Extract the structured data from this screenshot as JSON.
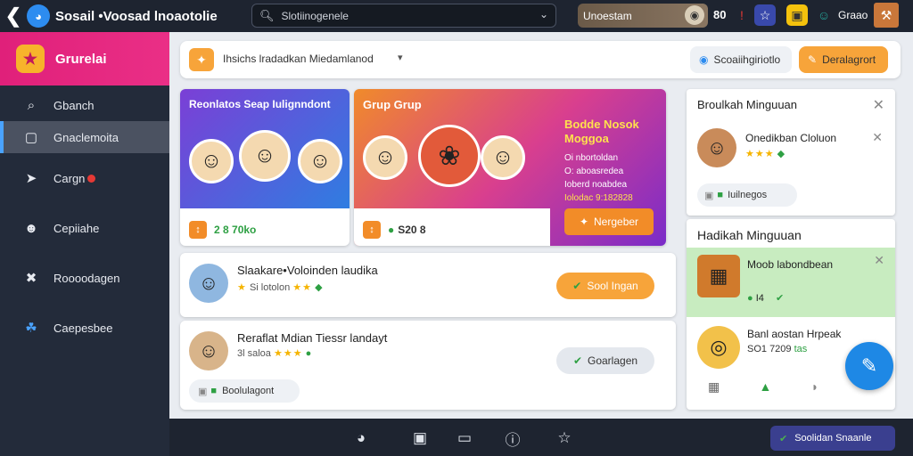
{
  "topbar": {
    "app_title": "Sosail •Voosad lnoaotolie",
    "search_text": "Slotiinogenele",
    "user_name": "Unoestam",
    "count": "80",
    "right_user": "Graao"
  },
  "sidebar": {
    "header": "Grurelai",
    "items": [
      {
        "label": "Gbanch",
        "icon": "search-icon"
      },
      {
        "label": "Gnaclemoita",
        "icon": "calendar-icon"
      },
      {
        "label": "Cargn",
        "icon": "rocket-icon"
      },
      {
        "label": "Cepiiahe",
        "icon": "profile-icon"
      },
      {
        "label": "Roooodagen",
        "icon": "tools-icon"
      },
      {
        "label": "Caepesbee",
        "icon": "creature-icon"
      }
    ]
  },
  "filterbar": {
    "text": "Ihsichs lradadkan Miedamlanod",
    "chip1": "Scoaiihgiriotlo",
    "chip2": "Deralagrort"
  },
  "cards": {
    "card1": {
      "title": "Reonlatos Seap Iulignndont",
      "stat": "2 8 70ko"
    },
    "card2": {
      "title": "Grup Grup",
      "stat": "S20 8",
      "promo_title": "Bodde Nosok Moggoa",
      "promo_lines": [
        "Oi nbortoldan",
        "O: aboasredea",
        "Ioberd noabdea",
        "Iolodac 9:182828"
      ],
      "promo_button": "Nergeber"
    }
  },
  "rows": [
    {
      "name": "Slaakare•Voloinden laudika",
      "sub": "Si lotolon",
      "button": "Sool Ingan"
    },
    {
      "name": "Reraflat Mdian Tiessr landayt",
      "sub": "3l saloa",
      "button": "Goarlagen",
      "tag": "Boolulagont"
    }
  ],
  "right_panel": {
    "card1_title": "Broulkah Minguuan",
    "card1_name": "Onedikban Cloluon",
    "card1_tag": "Iuilnegos",
    "card2_title": "Hadikah Minguuan",
    "item1_name": "Moob labondbean",
    "item1_count": "I4",
    "item2_name": "Banl aostan Hrpeak",
    "item2_sub": "SO1 7209",
    "item2_extra": "tas"
  },
  "bottombar": {
    "button": "Soolidan Snaanle"
  }
}
